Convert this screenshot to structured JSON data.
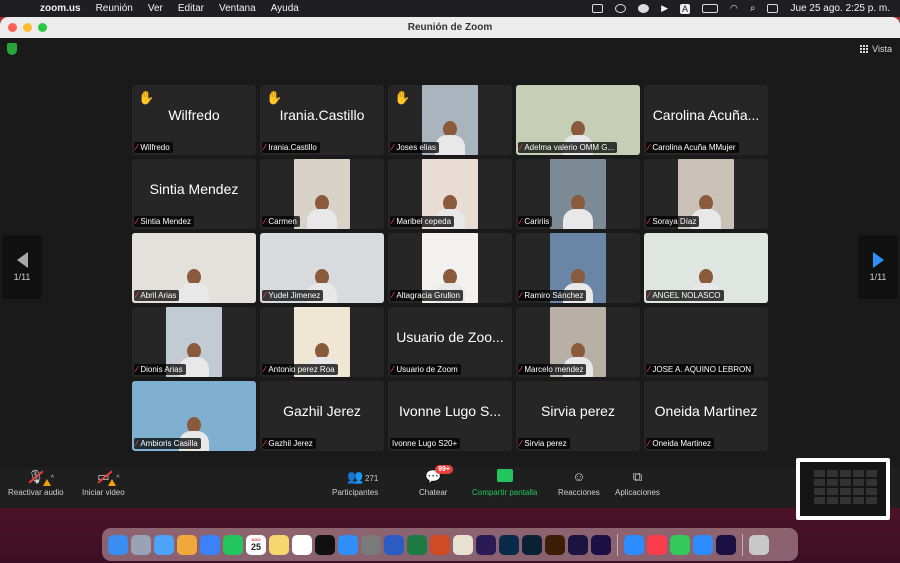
{
  "menubar": {
    "app_name": "zoom.us",
    "menus": [
      "Reunión",
      "Ver",
      "Editar",
      "Ventana",
      "Ayuda"
    ],
    "datetime": "Jue 25 ago.  2:25 p. m.",
    "letter_indicator": "A"
  },
  "window": {
    "title": "Reunión de Zoom",
    "view_label": "Vista",
    "page_indicator": "1/11"
  },
  "participants": [
    {
      "name": "Wilfredo",
      "big": "Wilfredo",
      "hand": true
    },
    {
      "name": "Irania.Castillo",
      "big": "Irania.Castillo",
      "hand": true
    },
    {
      "name": "Joses elias",
      "video": "#a9b4be",
      "hand": true
    },
    {
      "name": "Adelma valerio  OMM G...",
      "video": "#c6cfb6"
    },
    {
      "name": "Carolina Acuña MMujer",
      "big": "Carolina Acuña..."
    },
    {
      "name": "Sintia Mendez",
      "big": "Sintia Mendez"
    },
    {
      "name": "Carmen",
      "video": "#d9d2c8"
    },
    {
      "name": "Maribel cepeda",
      "video": "#e8dcd4"
    },
    {
      "name": "Caririis",
      "video": "#7b8a94"
    },
    {
      "name": "Soraya Díaz",
      "video": "#c9c1b8"
    },
    {
      "name": "Abril Arias",
      "video": "#e4e1dc",
      "active": true
    },
    {
      "name": "Yudel Jimenez",
      "video": "#d8dadd"
    },
    {
      "name": "Altagracia Grullon",
      "video": "#f3f1ee"
    },
    {
      "name": "Ramiro Sánchez",
      "video": "#6a86a6"
    },
    {
      "name": "ANGEL NOLASCO",
      "video": "#dfe5e0"
    },
    {
      "name": "Dionis Arias",
      "video": "#c2cbd4"
    },
    {
      "name": "Antonio perez Roa",
      "video": "#efe7d4"
    },
    {
      "name": "Usuario de Zoom",
      "big": "Usuario de Zoo..."
    },
    {
      "name": "Marcelo mendez",
      "video": "#b8b0a6"
    },
    {
      "name": "JOSE A. AQUINO LEBRON",
      "big": ""
    },
    {
      "name": "Ambioris Casilla",
      "video": "#7fb0cf"
    },
    {
      "name": "Gazhil Jerez",
      "big": "Gazhil Jerez"
    },
    {
      "name": "Ivonne Lugo S20+",
      "big": "Ivonne Lugo S...",
      "unmuted": true
    },
    {
      "name": "Sirvia perez",
      "big": "Sirvia perez"
    },
    {
      "name": "Oneida Martinez",
      "big": "Oneida Martinez"
    }
  ],
  "toolbar": {
    "audio": "Reactivar audio",
    "video": "Iniciar video",
    "participants": "Participantes",
    "participants_count": "271",
    "chat": "Chatear",
    "chat_badge": "99+",
    "share": "Compartir pantalla",
    "reactions": "Reacciones",
    "apps": "Aplicaciones"
  },
  "dock": {
    "calendar_month": "AGO",
    "calendar_day": "25",
    "apps": [
      "Finder",
      "Launchpad",
      "Mail",
      "Photos",
      "Safari",
      "FaceTime",
      "Calendar",
      "Notes",
      "Reminders",
      "TV",
      "App Store",
      "System Preferences",
      "Word",
      "Excel",
      "PowerPoint",
      "SO",
      "Bridge",
      "Photoshop",
      "Lightroom Classic",
      "Illustrator",
      "Premiere",
      "After Effects",
      "Zoom",
      "Music",
      "Messages",
      "Zoom Meetings",
      "After Effects",
      "Trash"
    ]
  },
  "colors": {
    "accent_green": "#22c55e",
    "mute_red": "#e8403c",
    "share_green": "#22c55e",
    "next_arrow": "#2f8ff7"
  }
}
